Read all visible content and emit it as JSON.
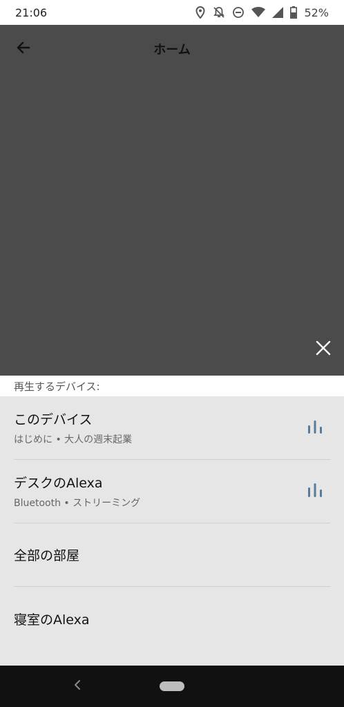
{
  "status_bar": {
    "time": "21:06",
    "battery": "52%",
    "icons": [
      "location-icon",
      "notifications-off-icon",
      "do-not-disturb-icon",
      "wifi-icon",
      "signal-icon",
      "battery-icon"
    ]
  },
  "header": {
    "title": "ホーム",
    "back_icon": "arrow-left-icon",
    "close_icon": "close-icon"
  },
  "sheet": {
    "section_label": "再生するデバイス:",
    "items": [
      {
        "title": "このデバイス",
        "subtitle": "はじめに • 大人の週末起業",
        "playing": true
      },
      {
        "title": "デスクのAlexa",
        "subtitle": "Bluetooth • ストリーミング",
        "playing": true
      },
      {
        "title": "全部の部屋",
        "subtitle": "",
        "playing": false
      },
      {
        "title": "寝室のAlexa",
        "subtitle": "",
        "playing": false
      }
    ]
  },
  "colors": {
    "overlay": "#4b4b4b",
    "sheet_bg": "#e6e6e6",
    "eq_icon": "#5a7a99",
    "nav_bg": "#111111"
  }
}
